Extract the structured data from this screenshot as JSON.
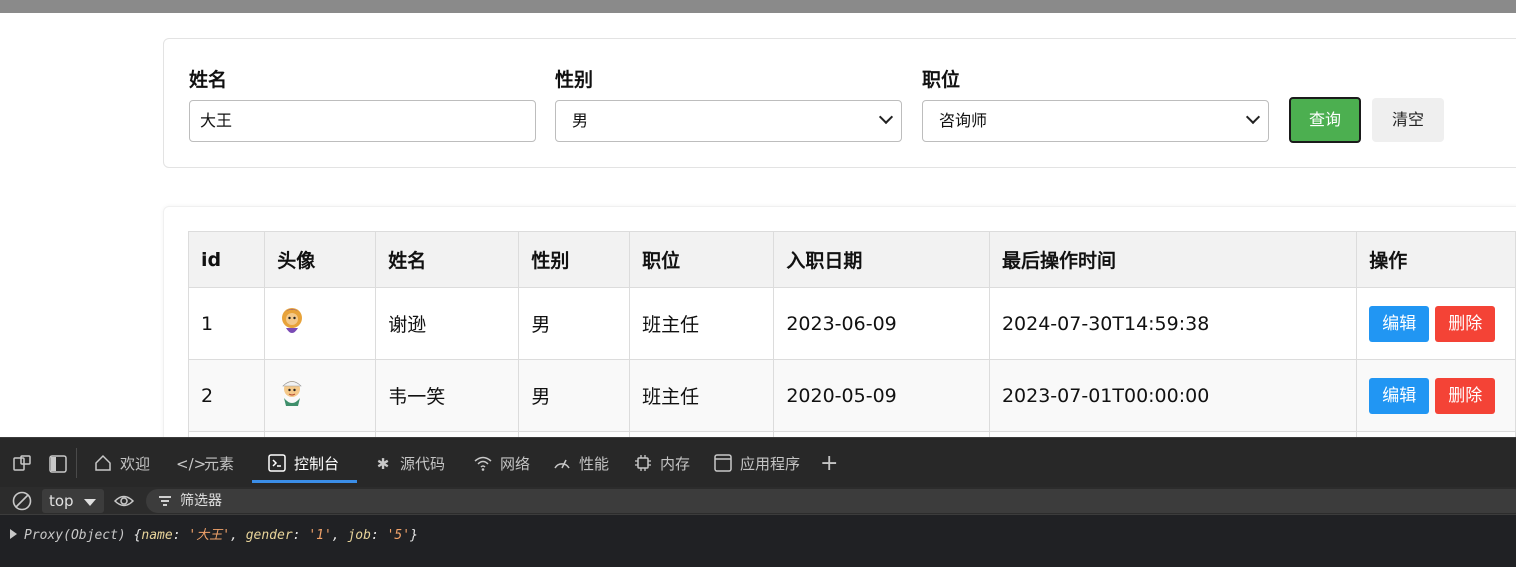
{
  "search": {
    "name_label": "姓名",
    "name_value": "大王",
    "gender_label": "性别",
    "gender_value": "男",
    "job_label": "职位",
    "job_value": "咨询师",
    "query_button": "查询",
    "clear_button": "清空"
  },
  "table": {
    "headers": [
      "id",
      "头像",
      "姓名",
      "性别",
      "职位",
      "入职日期",
      "最后操作时间",
      "操作"
    ],
    "rows": [
      {
        "id": "1",
        "name": "谢逊",
        "gender": "男",
        "job": "班主任",
        "entry_date": "2023-06-09",
        "update_time": "2024-07-30T14:59:38"
      },
      {
        "id": "2",
        "name": "韦一笑",
        "gender": "男",
        "job": "班主任",
        "entry_date": "2020-05-09",
        "update_time": "2023-07-01T00:00:00"
      }
    ],
    "edit_label": "编辑",
    "delete_label": "删除"
  },
  "devtools": {
    "tabs": [
      "欢迎",
      "元素",
      "控制台",
      "源代码",
      "网络",
      "性能",
      "内存",
      "应用程序"
    ],
    "active_tab": "控制台",
    "context": "top",
    "filter_placeholder": "筛选器",
    "console": {
      "prefix": "Proxy(Object)",
      "k1": "name",
      "v1": "'大王'",
      "k2": "gender",
      "v2": "'1'",
      "k3": "job",
      "v3": "'5'"
    }
  },
  "colors": {
    "query": "#4caf50",
    "edit": "#2196f3",
    "delete": "#f44336",
    "devtools_accent": "#3b8ee8"
  }
}
